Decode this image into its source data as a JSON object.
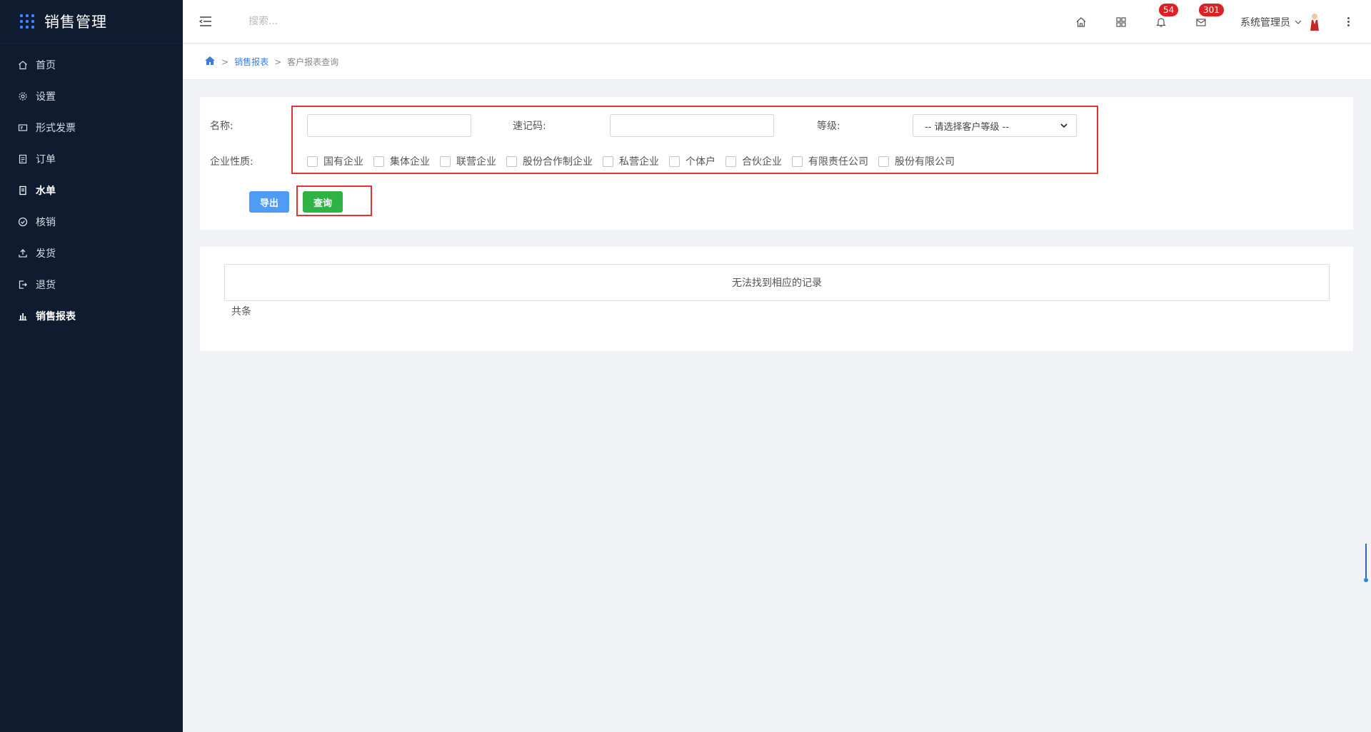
{
  "sidebar": {
    "title": "销售管理",
    "items": [
      {
        "label": "首页",
        "icon": "home-icon",
        "bold": false
      },
      {
        "label": "设置",
        "icon": "gear-icon",
        "bold": false
      },
      {
        "label": "形式发票",
        "icon": "invoice-icon",
        "bold": false
      },
      {
        "label": "订单",
        "icon": "order-icon",
        "bold": false
      },
      {
        "label": "水单",
        "icon": "receipt-icon",
        "bold": true
      },
      {
        "label": "核销",
        "icon": "check-circle-icon",
        "bold": false
      },
      {
        "label": "发货",
        "icon": "upload-icon",
        "bold": false
      },
      {
        "label": "退货",
        "icon": "return-icon",
        "bold": false
      },
      {
        "label": "销售报表",
        "icon": "bar-chart-icon",
        "bold": true
      }
    ]
  },
  "header": {
    "search_placeholder": "搜索...",
    "notifications_count": "54",
    "messages_count": "301",
    "user_name": "系统管理员"
  },
  "breadcrumb": {
    "level1": "销售报表",
    "level2": "客户报表查询",
    "separator": ">"
  },
  "filter": {
    "name_label": "名称:",
    "name_value": "",
    "code_label": "速记码:",
    "code_value": "",
    "level_label": "等级:",
    "level_selected": "-- 请选择客户等级 --",
    "nature_label": "企业性质:",
    "nature_options": [
      "国有企业",
      "集体企业",
      "联营企业",
      "股份合作制企业",
      "私营企业",
      "个体户",
      "合伙企业",
      "有限责任公司",
      "股份有限公司"
    ],
    "export_label": "导出",
    "query_label": "查询"
  },
  "result": {
    "empty_text": "无法找到相应的记录",
    "total_text": "共条"
  },
  "colors": {
    "sidebar_bg": "#0f1b2f",
    "accent_blue": "#4e9cf5",
    "accent_green": "#2fb344",
    "highlight_red": "#e3342f",
    "badge_red": "#e02020"
  }
}
